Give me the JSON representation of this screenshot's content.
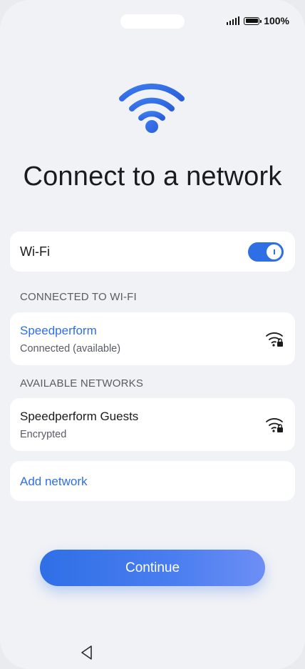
{
  "status_bar": {
    "battery_percent": "100%",
    "icons": [
      "signal-icon",
      "battery-icon"
    ]
  },
  "hero": {
    "icon": "wifi-icon"
  },
  "page": {
    "title": "Connect to a network"
  },
  "wifi_toggle": {
    "label": "Wi-Fi",
    "state": "on"
  },
  "connected_section": {
    "header": "CONNECTED TO WI-FI",
    "network": {
      "name": "Speedperform",
      "status": "Connected (available)",
      "icon": "wifi-lock-icon"
    }
  },
  "available_section": {
    "header": "AVAILABLE NETWORKS",
    "networks": [
      {
        "name": "Speedperform Guests",
        "status": "Encrypted",
        "icon": "wifi-lock-icon"
      }
    ]
  },
  "add_network": {
    "label": "Add network"
  },
  "continue_button": {
    "label": "Continue"
  },
  "nav": {
    "icon": "back-triangle-icon"
  },
  "colors": {
    "accent": "#2f6fe6",
    "background": "#f1f2f6",
    "card": "#ffffff"
  }
}
